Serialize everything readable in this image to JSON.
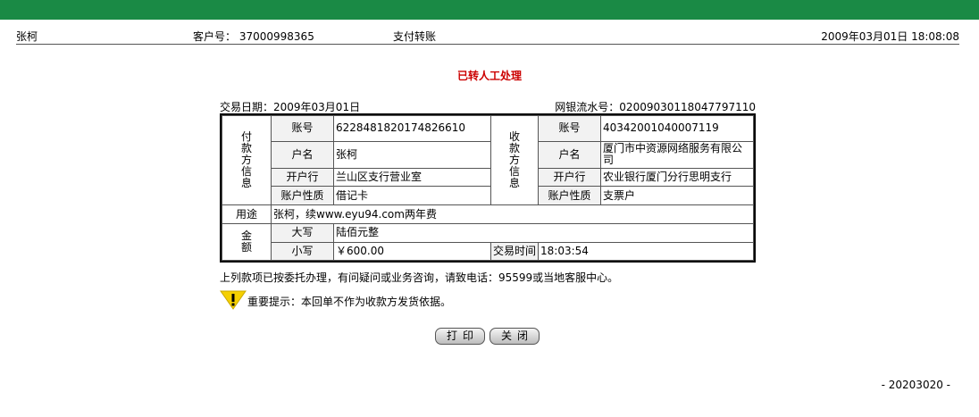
{
  "header": {
    "user_name": "张柯",
    "customer_label": "客户号：",
    "customer_no": "37000998365",
    "page_name": "支付转账",
    "datetime": "2009年03月01日  18:08:08"
  },
  "status_title": "已转人工处理",
  "meta": {
    "trade_date": "交易日期：2009年03月01日",
    "serial": "网银流水号：020090301180477971​10"
  },
  "payer": {
    "section": [
      "付",
      "款",
      "方",
      "信",
      "息"
    ],
    "account_label": "账号",
    "account": "6228481820174826610",
    "name_label": "户名",
    "name": "张柯",
    "bank_label": "开户行",
    "bank": "兰山区支行营业室",
    "type_label": "账户性质",
    "type": "借记卡"
  },
  "payee": {
    "section": [
      "收",
      "款",
      "方",
      "信",
      "息"
    ],
    "account_label": "账号",
    "account": "40342001040007119",
    "name_label": "户名",
    "name": "厦门市中资源网络服务有限公司",
    "bank_label": "开户行",
    "bank": "农业银行厦门分行思明支行",
    "type_label": "账户性质",
    "type": "支票户"
  },
  "purpose": {
    "label": "用途",
    "value": "张柯，续www.eyu94.com两年费"
  },
  "amount": {
    "section": [
      "金",
      "额"
    ],
    "upper_label": "大写",
    "upper": "陆佰元整",
    "lower_label": "小写",
    "lower": "￥600.00",
    "time_label": "交易时间",
    "time": "18:03:54"
  },
  "notice": "上列款项已按委托办理，有问疑问或业务咨询，请致电话：95599或当地客服中心。",
  "warning": "重要提示：本回单不作为收款方发货依据。",
  "buttons": {
    "print": "打印",
    "close": "关闭"
  },
  "footer_code": "- 20203020 -",
  "colors": {
    "topbar": "#1a8a45",
    "status": "#cc0000",
    "warning_icon": "#f5d000"
  }
}
